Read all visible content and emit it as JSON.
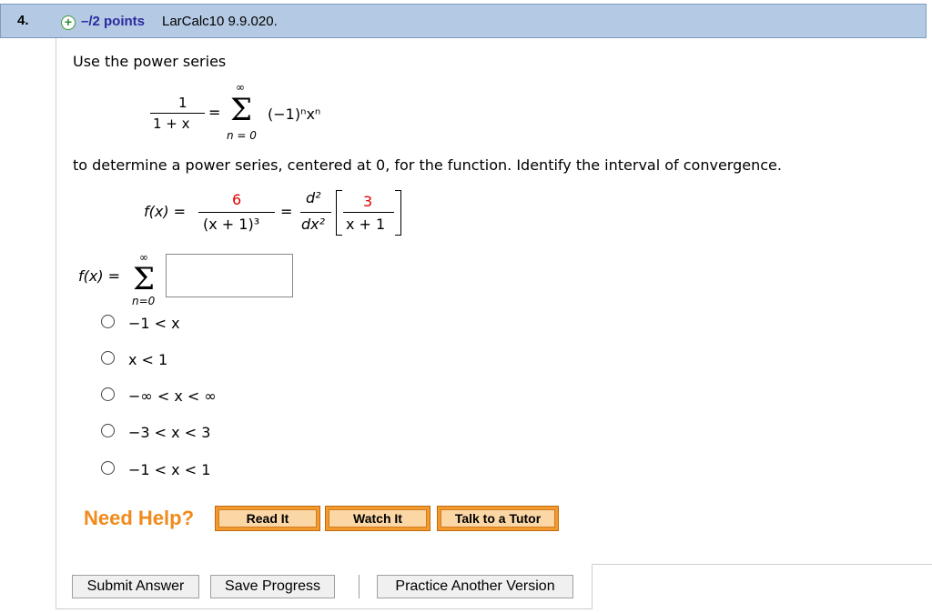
{
  "header": {
    "question_number": "4.",
    "points": "–/2 points",
    "question_id": "LarCalc10 9.9.020."
  },
  "prompt": {
    "intro": "Use the power series",
    "given_lhs_num": "1",
    "given_lhs_den": "1 + x",
    "equals": "=",
    "sigma_top": "∞",
    "sigma_bottom": "n = 0",
    "summand": "(−1)ⁿxⁿ",
    "instruction": "to determine a power series, centered at 0, for the function. Identify the interval of convergence.",
    "fx_label": "f(x) =",
    "fx_num": "6",
    "fx_den": "(x + 1)³",
    "deriv_num": "d²",
    "deriv_den": "dx²",
    "inner_num": "3",
    "inner_den": "x + 1"
  },
  "answer": {
    "label": "f(x) =",
    "sigma_top": "∞",
    "sigma_bottom": "n=0",
    "input_value": ""
  },
  "options": [
    {
      "label": "−1 < x"
    },
    {
      "label": "x < 1"
    },
    {
      "label": "−∞ < x < ∞"
    },
    {
      "label": "−3 < x < 3"
    },
    {
      "label": "−1 < x < 1"
    }
  ],
  "help": {
    "title": "Need Help?",
    "read": "Read It",
    "watch": "Watch It",
    "tutor": "Talk to a Tutor"
  },
  "actions": {
    "submit": "Submit Answer",
    "save": "Save Progress",
    "practice": "Practice Another Version"
  }
}
